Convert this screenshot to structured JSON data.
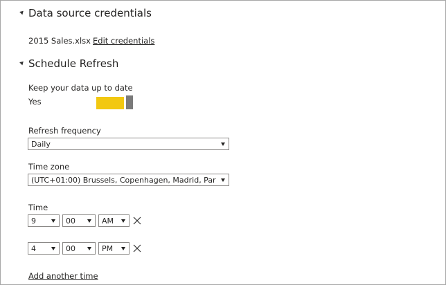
{
  "credentials": {
    "heading": "Data source credentials",
    "file_name": "2015 Sales.xlsx",
    "edit_link": "Edit credentials"
  },
  "schedule": {
    "heading": "Schedule Refresh",
    "keep_up_to_date_label": "Keep your data up to date",
    "toggle_value_label": "Yes",
    "toggle_on": true,
    "toggle_color": "#f2c811",
    "frequency_label": "Refresh frequency",
    "frequency_value": "Daily",
    "timezone_label": "Time zone",
    "timezone_value": "(UTC+01:00) Brussels, Copenhagen, Madrid, Par",
    "time_label": "Time",
    "times": [
      {
        "hour": "9",
        "minute": "00",
        "ampm": "AM"
      },
      {
        "hour": "4",
        "minute": "00",
        "ampm": "PM"
      }
    ],
    "add_time_link": "Add another time"
  }
}
